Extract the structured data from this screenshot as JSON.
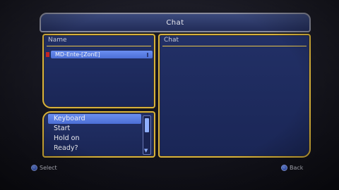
{
  "window": {
    "title": "Chat"
  },
  "name_panel": {
    "header": "Name",
    "players": [
      {
        "name": "MD-Ente-[ZonE]"
      }
    ]
  },
  "chat_panel": {
    "header": "Chat"
  },
  "menu": {
    "items": [
      {
        "label": "Keyboard",
        "selected": true
      },
      {
        "label": "Start",
        "selected": false
      },
      {
        "label": "Hold on",
        "selected": false
      },
      {
        "label": "Ready?",
        "selected": false
      }
    ],
    "scroll_arrow": "▼"
  },
  "footer": {
    "select_label": "Select",
    "back_label": "Back",
    "select_icon": "circle-button-icon",
    "back_icon": "circle-button-icon"
  },
  "colors": {
    "panel_border": "#d8b23a",
    "panel_fill": "#1f2c60",
    "highlight": "#5a7ee6",
    "marker": "#c42424"
  }
}
